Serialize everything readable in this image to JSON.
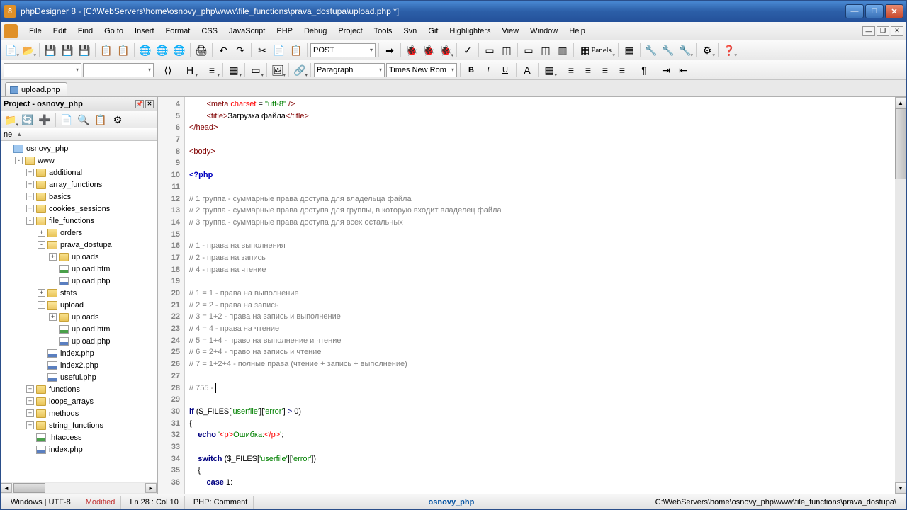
{
  "title": "phpDesigner 8 - [C:\\WebServers\\home\\osnovy_php\\www\\file_functions\\prava_dostupa\\upload.php *]",
  "menu": [
    "File",
    "Edit",
    "Find",
    "Go to",
    "Insert",
    "Format",
    "CSS",
    "JavaScript",
    "PHP",
    "Debug",
    "Project",
    "Tools",
    "Svn",
    "Git",
    "Highlighters",
    "View",
    "Window",
    "Help"
  ],
  "toolbar2": {
    "method_dropdown": "POST",
    "panels_label": "Panels"
  },
  "toolbar3": {
    "paragraph": "Paragraph",
    "font": "Times New Rom"
  },
  "tab": {
    "label": "upload.php"
  },
  "sidebar": {
    "title": "Project - osnovy_php",
    "col": "ne",
    "tree": [
      {
        "indent": 0,
        "toggle": "",
        "icon": "proj",
        "label": "osnovy_php"
      },
      {
        "indent": 1,
        "toggle": "-",
        "icon": "folderopen",
        "label": "www"
      },
      {
        "indent": 2,
        "toggle": "+",
        "icon": "folder",
        "label": "additional"
      },
      {
        "indent": 2,
        "toggle": "+",
        "icon": "folder",
        "label": "array_functions"
      },
      {
        "indent": 2,
        "toggle": "+",
        "icon": "folder",
        "label": "basics"
      },
      {
        "indent": 2,
        "toggle": "+",
        "icon": "folder",
        "label": "cookies_sessions"
      },
      {
        "indent": 2,
        "toggle": "-",
        "icon": "folderopen",
        "label": "file_functions"
      },
      {
        "indent": 3,
        "toggle": "+",
        "icon": "folder",
        "label": "orders"
      },
      {
        "indent": 3,
        "toggle": "-",
        "icon": "folderopen",
        "label": "prava_dostupa"
      },
      {
        "indent": 4,
        "toggle": "+",
        "icon": "folder",
        "label": "uploads"
      },
      {
        "indent": 4,
        "toggle": " ",
        "icon": "htm",
        "label": "upload.htm"
      },
      {
        "indent": 4,
        "toggle": " ",
        "icon": "php",
        "label": "upload.php"
      },
      {
        "indent": 3,
        "toggle": "+",
        "icon": "folder",
        "label": "stats"
      },
      {
        "indent": 3,
        "toggle": "-",
        "icon": "folderopen",
        "label": "upload"
      },
      {
        "indent": 4,
        "toggle": "+",
        "icon": "folder",
        "label": "uploads"
      },
      {
        "indent": 4,
        "toggle": " ",
        "icon": "htm",
        "label": "upload.htm"
      },
      {
        "indent": 4,
        "toggle": " ",
        "icon": "php",
        "label": "upload.php"
      },
      {
        "indent": 3,
        "toggle": " ",
        "icon": "php",
        "label": "index.php"
      },
      {
        "indent": 3,
        "toggle": " ",
        "icon": "php",
        "label": "index2.php"
      },
      {
        "indent": 3,
        "toggle": " ",
        "icon": "php",
        "label": "useful.php"
      },
      {
        "indent": 2,
        "toggle": "+",
        "icon": "folder",
        "label": "functions"
      },
      {
        "indent": 2,
        "toggle": "+",
        "icon": "folder",
        "label": "loops_arrays"
      },
      {
        "indent": 2,
        "toggle": "+",
        "icon": "folder",
        "label": "methods"
      },
      {
        "indent": 2,
        "toggle": "+",
        "icon": "folder",
        "label": "string_functions"
      },
      {
        "indent": 2,
        "toggle": " ",
        "icon": "htm",
        "label": ".htaccess"
      },
      {
        "indent": 2,
        "toggle": " ",
        "icon": "php",
        "label": "index.php"
      }
    ]
  },
  "editor": {
    "first_line": 4,
    "lines": [
      {
        "n": 4,
        "html": "        <span class='c-tag'>&lt;meta</span> <span class='c-attr'>charset</span> = <span class='c-val'>\"utf-8\"</span> <span class='c-tag'>/&gt;</span>"
      },
      {
        "n": 5,
        "html": "        <span class='c-tag'>&lt;title&gt;</span>Загрузка файла<span class='c-tag'>&lt;/title&gt;</span>"
      },
      {
        "n": 6,
        "html": "<span class='c-tag'>&lt;/head&gt;</span>"
      },
      {
        "n": 7,
        "html": ""
      },
      {
        "n": 8,
        "html": "<span class='c-tag'>&lt;body&gt;</span>"
      },
      {
        "n": 9,
        "html": ""
      },
      {
        "n": 10,
        "html": "<span class='c-keyword'>&lt;?php</span>"
      },
      {
        "n": 11,
        "html": ""
      },
      {
        "n": 12,
        "html": "<span class='c-comment'>// 1 группа - суммарные права доступа для владельца файла</span>"
      },
      {
        "n": 13,
        "html": "<span class='c-comment'>// 2 группа - суммарные права доступа для группы, в которую входит владелец файла</span>"
      },
      {
        "n": 14,
        "html": "<span class='c-comment'>// 3 группа - суммарные права доступа для всех остальных</span>"
      },
      {
        "n": 15,
        "html": ""
      },
      {
        "n": 16,
        "html": "<span class='c-comment'>// 1 - права на выполнения</span>"
      },
      {
        "n": 17,
        "html": "<span class='c-comment'>// 2 - права на запись</span>"
      },
      {
        "n": 18,
        "html": "<span class='c-comment'>// 4 - права на чтение</span>"
      },
      {
        "n": 19,
        "html": ""
      },
      {
        "n": 20,
        "html": "<span class='c-comment'>// 1 = 1 - права на выполнение</span>"
      },
      {
        "n": 21,
        "html": "<span class='c-comment'>// 2 = 2 - права на запись</span>"
      },
      {
        "n": 22,
        "html": "<span class='c-comment'>// 3 = 1+2 - права на запись и выполнение</span>"
      },
      {
        "n": 23,
        "html": "<span class='c-comment'>// 4 = 4 - права на чтение</span>"
      },
      {
        "n": 24,
        "html": "<span class='c-comment'>// 5 = 1+4 - право на выполнение и чтение</span>"
      },
      {
        "n": 25,
        "html": "<span class='c-comment'>// 6 = 2+4 - право на запись и чтение</span>"
      },
      {
        "n": 26,
        "html": "<span class='c-comment'>// 7 = 1+2+4 - полные права (чтение + запись + выполнение)</span>"
      },
      {
        "n": 27,
        "html": ""
      },
      {
        "n": 28,
        "html": "<span class='c-comment'>// 755 - </span><span class='cursor'></span>"
      },
      {
        "n": 29,
        "html": ""
      },
      {
        "n": 30,
        "html": "<span class='c-kw'>if</span> (<span class='c-var'>$_FILES</span>[<span class='c-string'>'userfile'</span>][<span class='c-string'>'error'</span>] <span class='c-op'>&gt;</span> 0)"
      },
      {
        "n": 31,
        "html": "{"
      },
      {
        "n": 32,
        "html": "    <span class='c-kw'>echo</span> <span class='c-string'>'</span><span class='c-strhtml'>&lt;p&gt;</span><span class='c-string'>Ошибка:</span><span class='c-strhtml'>&lt;/p&gt;</span><span class='c-string'>'</span>;"
      },
      {
        "n": 33,
        "html": ""
      },
      {
        "n": 34,
        "html": "    <span class='c-kw'>switch</span> (<span class='c-var'>$_FILES</span>[<span class='c-string'>'userfile'</span>][<span class='c-string'>'error'</span>])"
      },
      {
        "n": 35,
        "html": "    {"
      },
      {
        "n": 36,
        "html": "        <span class='c-kw'>case</span> 1:"
      }
    ]
  },
  "status": {
    "encoding": "Windows | UTF-8",
    "modified": "Modified",
    "pos": "Ln      28 : Col    10",
    "context": "PHP: Comment",
    "project": "osnovy_php",
    "path": "C:\\WebServers\\home\\osnovy_php\\www\\file_functions\\prava_dostupa\\"
  }
}
